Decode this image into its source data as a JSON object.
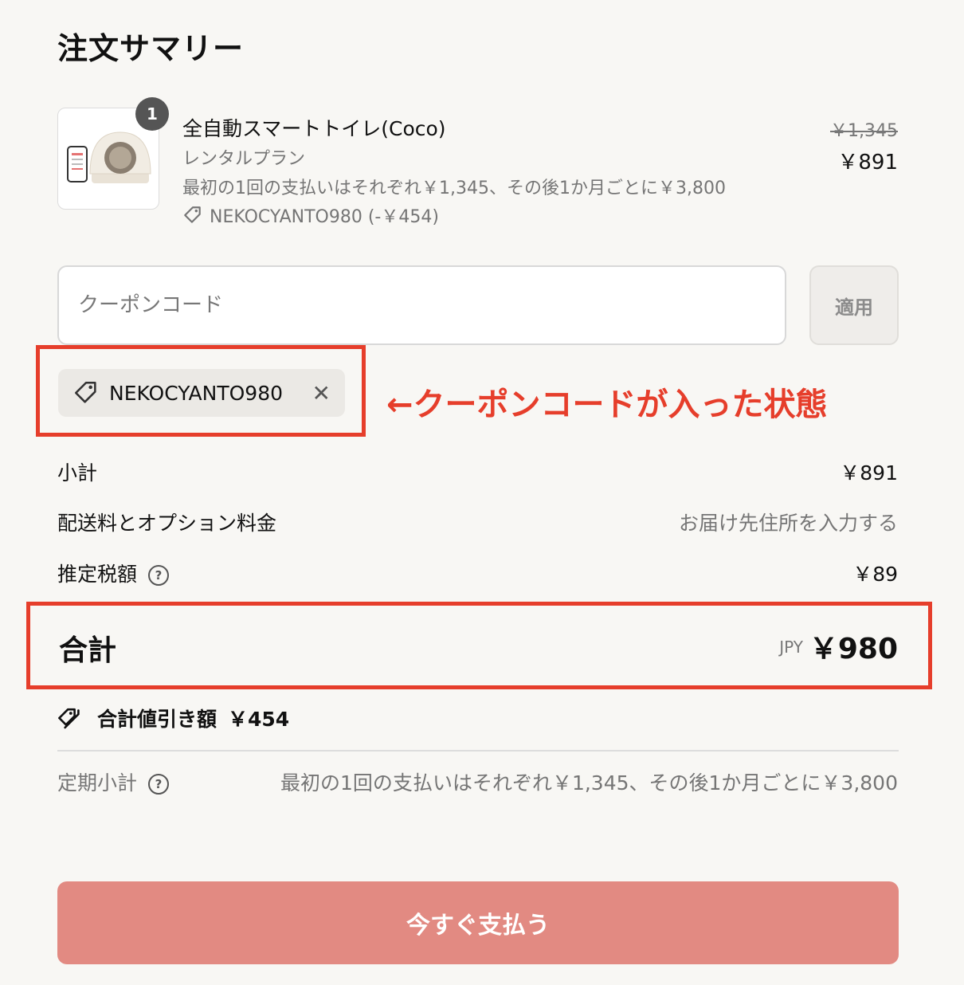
{
  "header": {
    "title": "注文サマリー"
  },
  "product": {
    "quantity": "1",
    "name": "全自動スマートトイレ(Coco)",
    "plan": "レンタルプラン",
    "payment_note": "最初の1回の支払いはそれぞれ￥1,345、その後1か月ごとに￥3,800",
    "coupon_line": "NEKOCYANTO980 (-￥454)",
    "original_price": "￥1,345",
    "price": "￥891",
    "image_icon": "cat-litter-robot-image"
  },
  "coupon": {
    "placeholder": "クーポンコード",
    "apply_label": "適用",
    "applied_code": "NEKOCYANTO980",
    "remove_icon": "close-icon"
  },
  "annotation": {
    "text": "←クーポンコードが入った状態",
    "color": "#e63e2b"
  },
  "summary": {
    "subtotal_label": "小計",
    "subtotal_value": "￥891",
    "shipping_label": "配送料とオプション料金",
    "shipping_value": "お届け先住所を入力する",
    "tax_label": "推定税額",
    "tax_value": "￥89",
    "total_label": "合計",
    "currency": "JPY",
    "total_value": "￥980",
    "discount_label": "合計値引き額",
    "discount_value": "￥454",
    "recurring_label": "定期小計",
    "recurring_value": "最初の1回の支払いはそれぞれ￥1,345、その後1か月ごとに￥3,800"
  },
  "pay_button": {
    "label": "今すぐ支払う",
    "color": "#e28a82"
  }
}
